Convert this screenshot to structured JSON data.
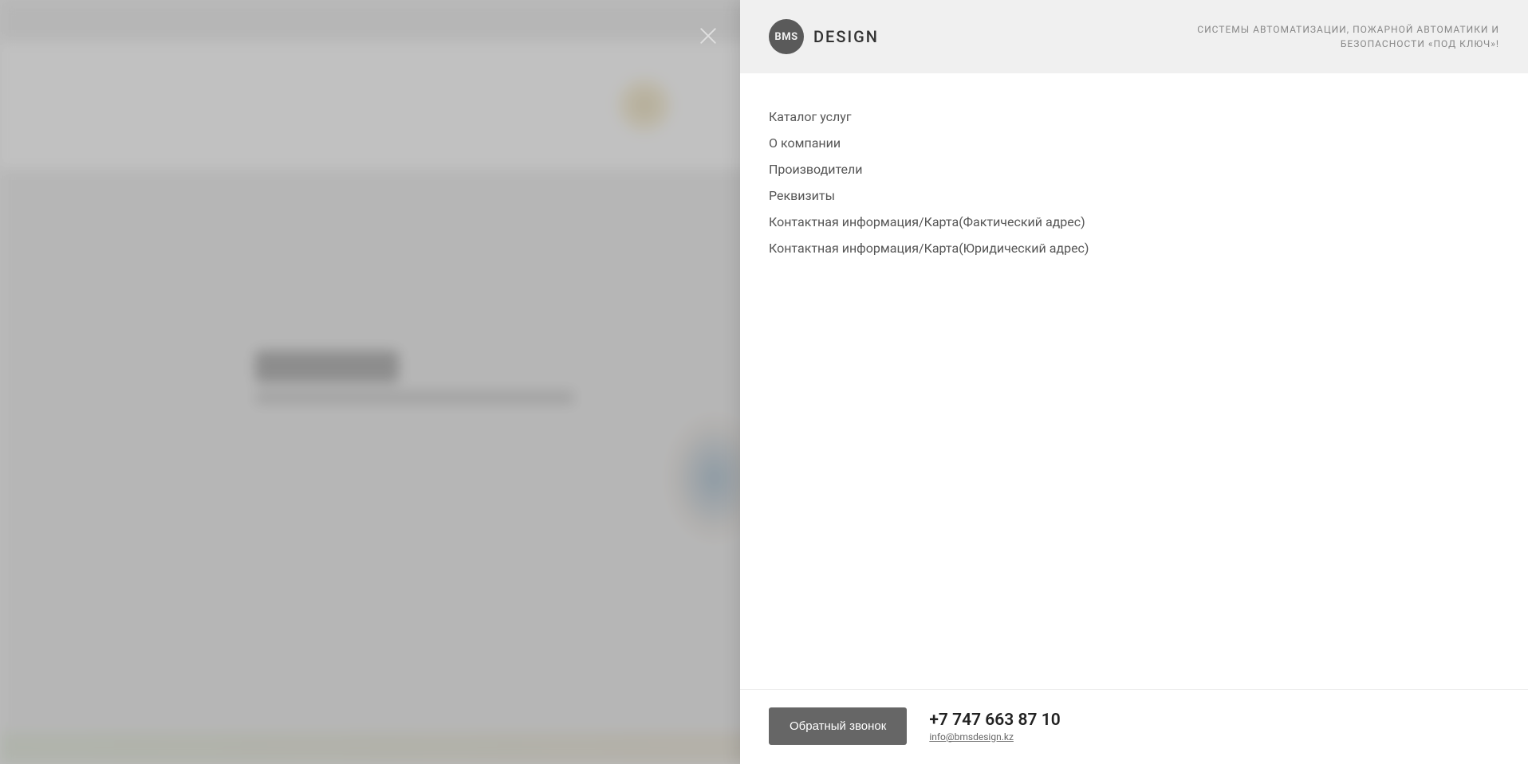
{
  "background": {
    "heading": "Реквизиты",
    "subtitle": "Реквизиты компании и юридической информации"
  },
  "close": {
    "aria": "Close"
  },
  "logo": {
    "badge": "BMS",
    "text": "DESIGN"
  },
  "tagline": {
    "line1": "СИСТЕМЫ АВТОМАТИЗАЦИИ, ПОЖАРНОЙ АВТОМАТИКИ И",
    "line2": "БЕЗОПАСНОСТИ «ПОД КЛЮЧ»!"
  },
  "nav": {
    "items": [
      {
        "label": "Каталог услуг"
      },
      {
        "label": "О компании"
      },
      {
        "label": "Производители"
      },
      {
        "label": "Реквизиты"
      },
      {
        "label": "Контактная информация/Карта(Фактический адрес)"
      },
      {
        "label": "Контактная информация/Карта(Юридический адрес)"
      }
    ]
  },
  "footer": {
    "callback": "Обратный звонок",
    "phone": "+7 747 663 87 10",
    "email": "info@bmsdesign.kz"
  }
}
